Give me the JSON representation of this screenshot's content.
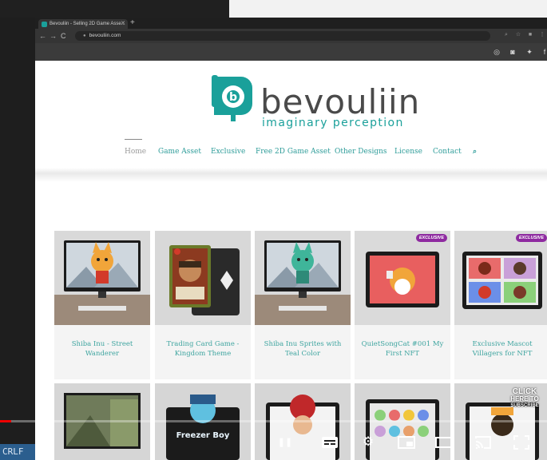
{
  "editor": {
    "status_eol": "CRLF"
  },
  "browser": {
    "tab_title": "Bevouliin - Selling 2D Game Asse...",
    "new_tab": "+",
    "back": "←",
    "forward": "→",
    "reload": "C",
    "url": "bevouliin.com"
  },
  "site": {
    "brand": "bevouliin",
    "tagline": "imaginary perception",
    "accent": "#1aa09a",
    "nav": [
      {
        "label": "Home"
      },
      {
        "label": "Game Asset"
      },
      {
        "label": "Exclusive"
      },
      {
        "label": "Free 2D Game Asset"
      },
      {
        "label": "Other Designs"
      },
      {
        "label": "License"
      },
      {
        "label": "Contact"
      }
    ],
    "search_icon": "search-icon",
    "social_icons": [
      "dribbble-icon",
      "instagram-icon",
      "twitter-icon",
      "facebook-icon"
    ]
  },
  "products": [
    {
      "title": "Shiba Inu - Street Wanderer",
      "badge": ""
    },
    {
      "title": "Trading Card Game - Kingdom Theme",
      "badge": ""
    },
    {
      "title": "Shiba Inu Sprites with Teal Color",
      "badge": ""
    },
    {
      "title": "QuietSongCat #001 My First NFT",
      "badge": "EXCLUSIVE"
    },
    {
      "title": "Exclusive Mascot Villagers for NFT",
      "badge": "EXCLUSIVE"
    }
  ],
  "products_row2": [
    {
      "art": "Freezer Boy"
    }
  ],
  "video": {
    "subscribe_line1": "CLICK",
    "subscribe_line2": "HERE TO",
    "subscribe_line3": "SUBSCRIBE",
    "played_fraction": 0.02
  }
}
